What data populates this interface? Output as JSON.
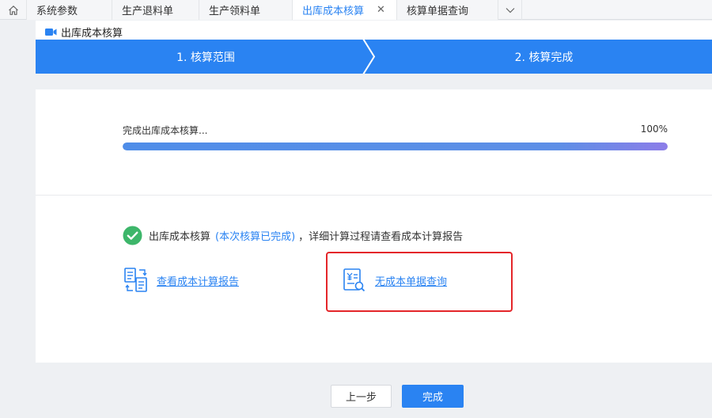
{
  "tabs": [
    {
      "label": "系统参数",
      "active": false
    },
    {
      "label": "生产退料单",
      "active": false
    },
    {
      "label": "生产领料单",
      "active": false
    },
    {
      "label": "出库成本核算",
      "active": true
    },
    {
      "label": "核算单据查询",
      "active": false
    }
  ],
  "page": {
    "title": "出库成本核算"
  },
  "steps": [
    {
      "label": "1. 核算范围"
    },
    {
      "label": "2. 核算完成"
    }
  ],
  "progress": {
    "label": "完成出库成本核算...",
    "percent_text": "100%",
    "value": 100
  },
  "result": {
    "main": "出库成本核算",
    "note": "(本次核算已完成)",
    "tail": "，详细计算过程请查看成本计算报告"
  },
  "links": {
    "report": "查看成本计算报告",
    "query": "无成本单据查询"
  },
  "buttons": {
    "prev": "上一步",
    "done": "完成"
  },
  "colors": {
    "primary": "#2a83f2",
    "success": "#3db66a",
    "highlight": "#e4262a"
  },
  "icons": {
    "home": "home-icon",
    "close": "close-icon",
    "more": "chevron-down-icon",
    "title": "video-icon",
    "check": "check-circle-icon",
    "report": "report-exchange-icon",
    "query": "bill-search-icon"
  }
}
